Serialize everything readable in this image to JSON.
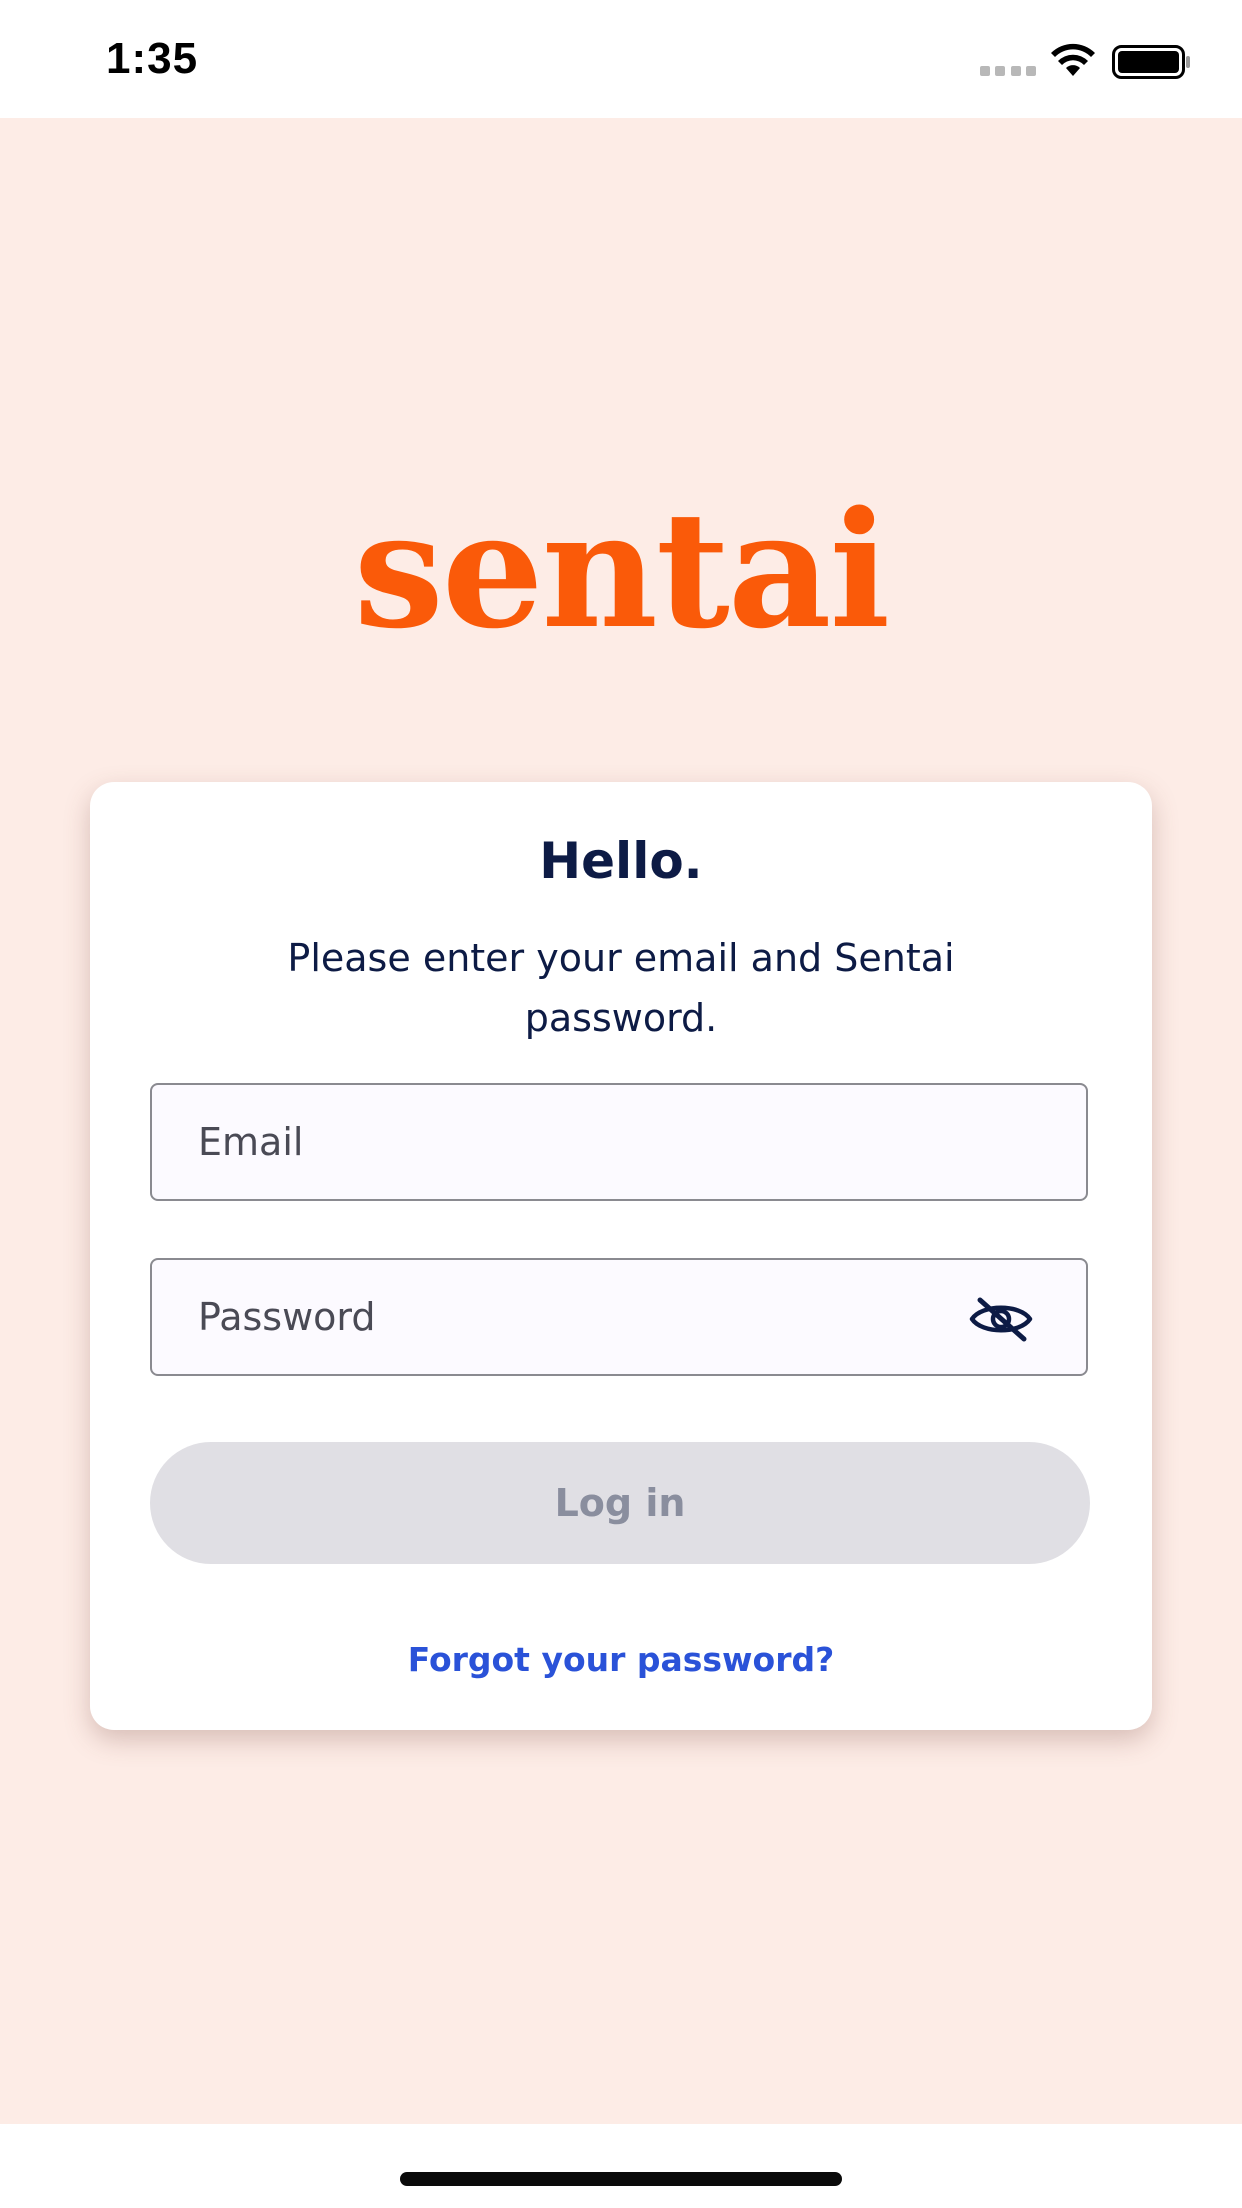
{
  "status_bar": {
    "time": "1:35"
  },
  "logo": {
    "text": "sentai",
    "color": "#fa5a09"
  },
  "card": {
    "title": "Hello.",
    "subtitle": "Please enter your email and Sentai password."
  },
  "form": {
    "email_placeholder": "Email",
    "password_placeholder": "Password",
    "password_toggle_icon": "eye-slash-icon",
    "login_label": "Log in",
    "forgot_label": "Forgot your password?"
  },
  "colors": {
    "background": "#fdece6",
    "text_primary": "#0d1b45",
    "link": "#2a52d8",
    "button_disabled": "#e0dfe4"
  }
}
